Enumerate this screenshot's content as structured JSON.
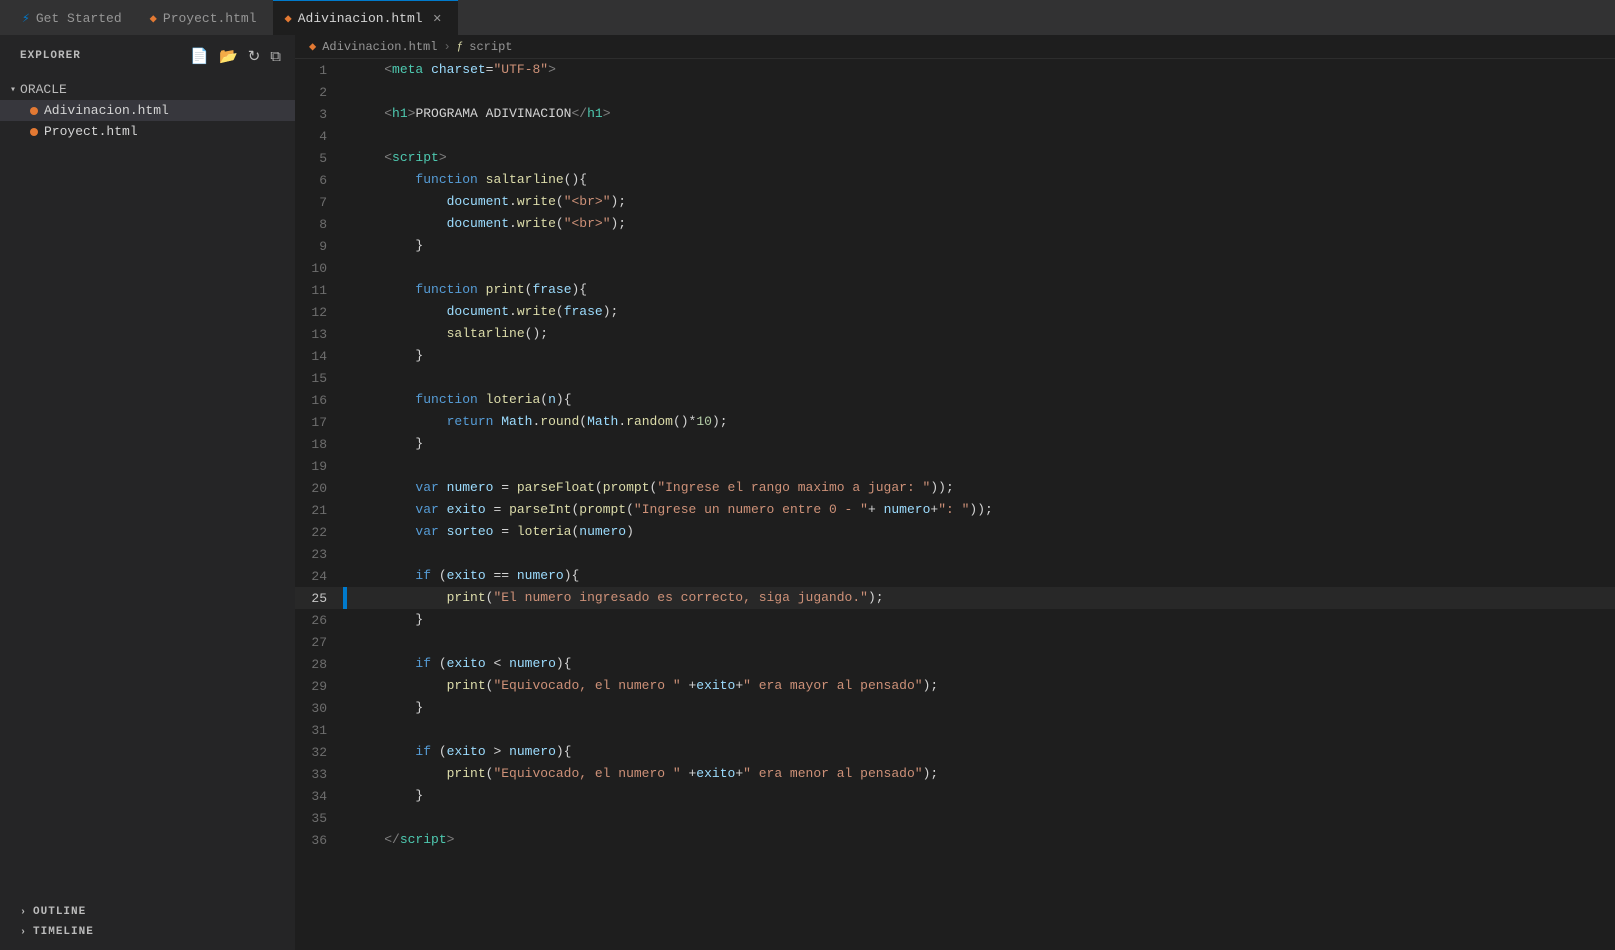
{
  "titlebar": {
    "tabs": [
      {
        "id": "get-started",
        "label": "Get Started",
        "icon": "get-started-icon",
        "active": false,
        "closable": false
      },
      {
        "id": "proyect",
        "label": "Proyect.html",
        "icon": "html-icon",
        "active": false,
        "closable": false
      },
      {
        "id": "adivinacion",
        "label": "Adivinacion.html",
        "icon": "html-icon",
        "active": true,
        "closable": true
      }
    ]
  },
  "sidebar": {
    "title": "EXPLORER",
    "section": "ORACLE",
    "files": [
      {
        "id": "adivinacion",
        "name": "Adivinacion.html",
        "active": true
      },
      {
        "id": "proyect",
        "name": "Proyect.html",
        "active": false
      }
    ],
    "bottom_sections": [
      {
        "id": "outline",
        "label": "OUTLINE"
      },
      {
        "id": "timeline",
        "label": "TIMELINE"
      }
    ]
  },
  "breadcrumb": {
    "file": "Adivinacion.html",
    "section": "script"
  },
  "lines": [
    {
      "num": 1,
      "tokens": [
        {
          "t": "    ",
          "c": "plain"
        },
        {
          "t": "<",
          "c": "tag-bracket"
        },
        {
          "t": "meta",
          "c": "tag-name"
        },
        {
          "t": " ",
          "c": "plain"
        },
        {
          "t": "charset",
          "c": "attr-name"
        },
        {
          "t": "=",
          "c": "punct"
        },
        {
          "t": "\"UTF-8\"",
          "c": "attr-val"
        },
        {
          "t": ">",
          "c": "tag-bracket"
        }
      ]
    },
    {
      "num": 2,
      "tokens": []
    },
    {
      "num": 3,
      "tokens": [
        {
          "t": "    ",
          "c": "plain"
        },
        {
          "t": "<",
          "c": "tag-bracket"
        },
        {
          "t": "h1",
          "c": "tag-name"
        },
        {
          "t": ">",
          "c": "tag-bracket"
        },
        {
          "t": "PROGRAMA ADIVINACION",
          "c": "plain"
        },
        {
          "t": "</",
          "c": "tag-bracket"
        },
        {
          "t": "h1",
          "c": "tag-name"
        },
        {
          "t": ">",
          "c": "tag-bracket"
        }
      ]
    },
    {
      "num": 4,
      "tokens": []
    },
    {
      "num": 5,
      "tokens": [
        {
          "t": "    ",
          "c": "plain"
        },
        {
          "t": "<",
          "c": "tag-bracket"
        },
        {
          "t": "script",
          "c": "tag-name"
        },
        {
          "t": ">",
          "c": "tag-bracket"
        }
      ]
    },
    {
      "num": 6,
      "tokens": [
        {
          "t": "        ",
          "c": "plain"
        },
        {
          "t": "function",
          "c": "kw"
        },
        {
          "t": " ",
          "c": "plain"
        },
        {
          "t": "saltarline",
          "c": "fn"
        },
        {
          "t": "(){",
          "c": "plain"
        }
      ]
    },
    {
      "num": 7,
      "tokens": [
        {
          "t": "            ",
          "c": "plain"
        },
        {
          "t": "document",
          "c": "var"
        },
        {
          "t": ".",
          "c": "plain"
        },
        {
          "t": "write",
          "c": "method"
        },
        {
          "t": "(",
          "c": "plain"
        },
        {
          "t": "\"<br>\"",
          "c": "str"
        },
        {
          "t": ");",
          "c": "plain"
        }
      ]
    },
    {
      "num": 8,
      "tokens": [
        {
          "t": "            ",
          "c": "plain"
        },
        {
          "t": "document",
          "c": "var"
        },
        {
          "t": ".",
          "c": "plain"
        },
        {
          "t": "write",
          "c": "method"
        },
        {
          "t": "(",
          "c": "plain"
        },
        {
          "t": "\"<br>\"",
          "c": "str"
        },
        {
          "t": ");",
          "c": "plain"
        }
      ]
    },
    {
      "num": 9,
      "tokens": [
        {
          "t": "        ",
          "c": "plain"
        },
        {
          "t": "}",
          "c": "plain"
        }
      ]
    },
    {
      "num": 10,
      "tokens": []
    },
    {
      "num": 11,
      "tokens": [
        {
          "t": "        ",
          "c": "plain"
        },
        {
          "t": "function",
          "c": "kw"
        },
        {
          "t": " ",
          "c": "plain"
        },
        {
          "t": "print",
          "c": "fn"
        },
        {
          "t": "(",
          "c": "plain"
        },
        {
          "t": "frase",
          "c": "var"
        },
        {
          "t": "){",
          "c": "plain"
        }
      ]
    },
    {
      "num": 12,
      "tokens": [
        {
          "t": "            ",
          "c": "plain"
        },
        {
          "t": "document",
          "c": "var"
        },
        {
          "t": ".",
          "c": "plain"
        },
        {
          "t": "write",
          "c": "method"
        },
        {
          "t": "(",
          "c": "plain"
        },
        {
          "t": "frase",
          "c": "var"
        },
        {
          "t": ");",
          "c": "plain"
        }
      ]
    },
    {
      "num": 13,
      "tokens": [
        {
          "t": "            ",
          "c": "plain"
        },
        {
          "t": "saltarline",
          "c": "fn"
        },
        {
          "t": "();",
          "c": "plain"
        }
      ]
    },
    {
      "num": 14,
      "tokens": [
        {
          "t": "        ",
          "c": "plain"
        },
        {
          "t": "}",
          "c": "plain"
        }
      ]
    },
    {
      "num": 15,
      "tokens": []
    },
    {
      "num": 16,
      "tokens": [
        {
          "t": "        ",
          "c": "plain"
        },
        {
          "t": "function",
          "c": "kw"
        },
        {
          "t": " ",
          "c": "plain"
        },
        {
          "t": "loteria",
          "c": "fn"
        },
        {
          "t": "(",
          "c": "plain"
        },
        {
          "t": "n",
          "c": "var"
        },
        {
          "t": "){",
          "c": "plain"
        }
      ]
    },
    {
      "num": 17,
      "tokens": [
        {
          "t": "            ",
          "c": "plain"
        },
        {
          "t": "return",
          "c": "kw"
        },
        {
          "t": " ",
          "c": "plain"
        },
        {
          "t": "Math",
          "c": "var"
        },
        {
          "t": ".",
          "c": "plain"
        },
        {
          "t": "round",
          "c": "method"
        },
        {
          "t": "(",
          "c": "plain"
        },
        {
          "t": "Math",
          "c": "var"
        },
        {
          "t": ".",
          "c": "plain"
        },
        {
          "t": "random",
          "c": "method"
        },
        {
          "t": "()*",
          "c": "plain"
        },
        {
          "t": "10",
          "c": "num"
        },
        {
          "t": ");",
          "c": "plain"
        }
      ]
    },
    {
      "num": 18,
      "tokens": [
        {
          "t": "        ",
          "c": "plain"
        },
        {
          "t": "}",
          "c": "plain"
        }
      ]
    },
    {
      "num": 19,
      "tokens": []
    },
    {
      "num": 20,
      "tokens": [
        {
          "t": "        ",
          "c": "plain"
        },
        {
          "t": "var",
          "c": "kw"
        },
        {
          "t": " ",
          "c": "plain"
        },
        {
          "t": "numero",
          "c": "var"
        },
        {
          "t": " = ",
          "c": "plain"
        },
        {
          "t": "parseFloat",
          "c": "fn"
        },
        {
          "t": "(",
          "c": "plain"
        },
        {
          "t": "prompt",
          "c": "fn"
        },
        {
          "t": "(",
          "c": "plain"
        },
        {
          "t": "\"Ingrese el rango maximo a jugar: \"",
          "c": "str"
        },
        {
          "t": "));",
          "c": "plain"
        }
      ]
    },
    {
      "num": 21,
      "tokens": [
        {
          "t": "        ",
          "c": "plain"
        },
        {
          "t": "var",
          "c": "kw"
        },
        {
          "t": " ",
          "c": "plain"
        },
        {
          "t": "exito",
          "c": "var"
        },
        {
          "t": " = ",
          "c": "plain"
        },
        {
          "t": "parseInt",
          "c": "fn"
        },
        {
          "t": "(",
          "c": "plain"
        },
        {
          "t": "prompt",
          "c": "fn"
        },
        {
          "t": "(",
          "c": "plain"
        },
        {
          "t": "\"Ingrese un numero entre 0 - \"",
          "c": "str"
        },
        {
          "t": "+ ",
          "c": "plain"
        },
        {
          "t": "numero",
          "c": "var"
        },
        {
          "t": "+",
          "c": "plain"
        },
        {
          "t": "\": \"",
          "c": "str"
        },
        {
          "t": "));",
          "c": "plain"
        }
      ]
    },
    {
      "num": 22,
      "tokens": [
        {
          "t": "        ",
          "c": "plain"
        },
        {
          "t": "var",
          "c": "kw"
        },
        {
          "t": " ",
          "c": "plain"
        },
        {
          "t": "sorteo",
          "c": "var"
        },
        {
          "t": " = ",
          "c": "plain"
        },
        {
          "t": "loteria",
          "c": "fn"
        },
        {
          "t": "(",
          "c": "plain"
        },
        {
          "t": "numero",
          "c": "var"
        },
        {
          "t": ")",
          "c": "plain"
        }
      ]
    },
    {
      "num": 23,
      "tokens": []
    },
    {
      "num": 24,
      "tokens": [
        {
          "t": "        ",
          "c": "plain"
        },
        {
          "t": "if",
          "c": "kw"
        },
        {
          "t": " (",
          "c": "plain"
        },
        {
          "t": "exito",
          "c": "var"
        },
        {
          "t": " == ",
          "c": "plain"
        },
        {
          "t": "numero",
          "c": "var"
        },
        {
          "t": "){",
          "c": "plain"
        }
      ]
    },
    {
      "num": 25,
      "tokens": [
        {
          "t": "            ",
          "c": "plain"
        },
        {
          "t": "print",
          "c": "fn"
        },
        {
          "t": "(",
          "c": "plain"
        },
        {
          "t": "\"El numero ingresado es correcto, siga ju",
          "c": "str"
        },
        {
          "t": "gando.",
          "c": "str"
        },
        {
          "t": "\"",
          "c": "str"
        },
        {
          "t": ");",
          "c": "plain"
        }
      ],
      "active": true,
      "indicator": true
    },
    {
      "num": 26,
      "tokens": [
        {
          "t": "        ",
          "c": "plain"
        },
        {
          "t": "}",
          "c": "plain"
        }
      ]
    },
    {
      "num": 27,
      "tokens": []
    },
    {
      "num": 28,
      "tokens": [
        {
          "t": "        ",
          "c": "plain"
        },
        {
          "t": "if",
          "c": "kw"
        },
        {
          "t": " (",
          "c": "plain"
        },
        {
          "t": "exito",
          "c": "var"
        },
        {
          "t": " < ",
          "c": "plain"
        },
        {
          "t": "numero",
          "c": "var"
        },
        {
          "t": "){",
          "c": "plain"
        }
      ]
    },
    {
      "num": 29,
      "tokens": [
        {
          "t": "            ",
          "c": "plain"
        },
        {
          "t": "print",
          "c": "fn"
        },
        {
          "t": "(",
          "c": "plain"
        },
        {
          "t": "\"Equivocado, el numero \"",
          "c": "str"
        },
        {
          "t": " +",
          "c": "plain"
        },
        {
          "t": "exito",
          "c": "var"
        },
        {
          "t": "+",
          "c": "plain"
        },
        {
          "t": "\" era mayor al pensado\"",
          "c": "str"
        },
        {
          "t": ");",
          "c": "plain"
        }
      ]
    },
    {
      "num": 30,
      "tokens": [
        {
          "t": "        ",
          "c": "plain"
        },
        {
          "t": "}",
          "c": "plain"
        }
      ]
    },
    {
      "num": 31,
      "tokens": []
    },
    {
      "num": 32,
      "tokens": [
        {
          "t": "        ",
          "c": "plain"
        },
        {
          "t": "if",
          "c": "kw"
        },
        {
          "t": " (",
          "c": "plain"
        },
        {
          "t": "exito",
          "c": "var"
        },
        {
          "t": " > ",
          "c": "plain"
        },
        {
          "t": "numero",
          "c": "var"
        },
        {
          "t": "){",
          "c": "plain"
        }
      ]
    },
    {
      "num": 33,
      "tokens": [
        {
          "t": "            ",
          "c": "plain"
        },
        {
          "t": "print",
          "c": "fn"
        },
        {
          "t": "(",
          "c": "plain"
        },
        {
          "t": "\"Equivocado, el numero \"",
          "c": "str"
        },
        {
          "t": " +",
          "c": "plain"
        },
        {
          "t": "exito",
          "c": "var"
        },
        {
          "t": "+",
          "c": "plain"
        },
        {
          "t": "\" era menor al pensado\"",
          "c": "str"
        },
        {
          "t": ");",
          "c": "plain"
        }
      ]
    },
    {
      "num": 34,
      "tokens": [
        {
          "t": "        ",
          "c": "plain"
        },
        {
          "t": "}",
          "c": "plain"
        }
      ]
    },
    {
      "num": 35,
      "tokens": []
    },
    {
      "num": 36,
      "tokens": [
        {
          "t": "    ",
          "c": "plain"
        },
        {
          "t": "</",
          "c": "tag-bracket"
        },
        {
          "t": "script",
          "c": "tag-name"
        },
        {
          "t": ">",
          "c": "tag-bracket"
        }
      ]
    }
  ]
}
